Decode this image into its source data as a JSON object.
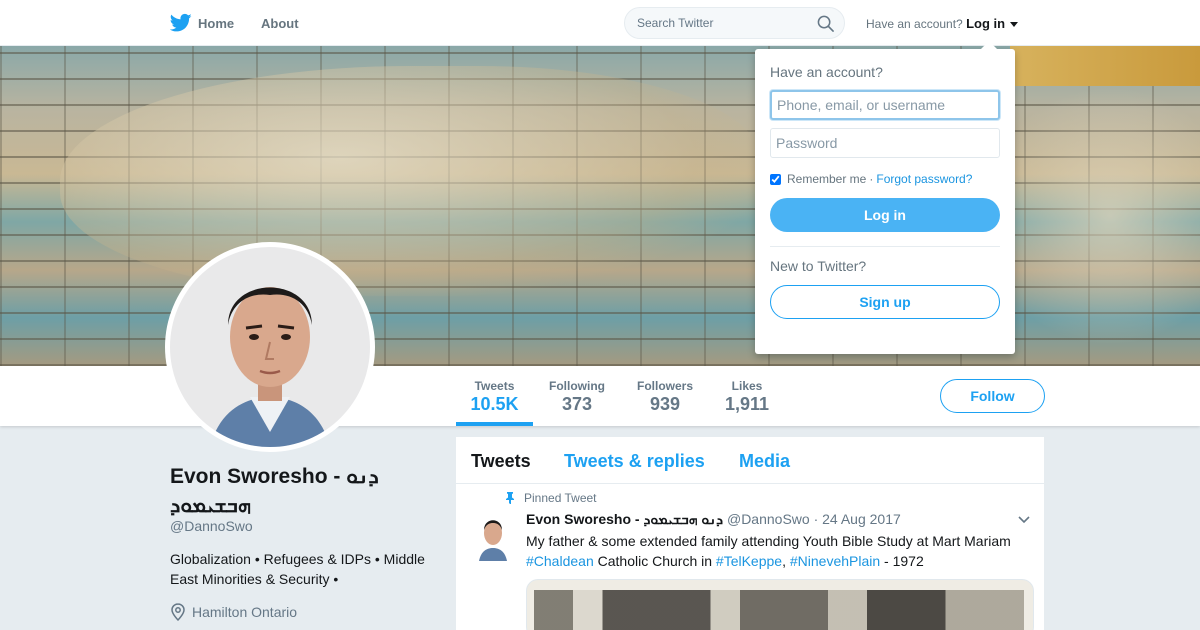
{
  "nav": {
    "home_label": "Home",
    "about_label": "About",
    "search_placeholder": "Search Twitter",
    "have_account": "Have an account?",
    "login_label": "Log in",
    "brand_color": "#1da1f2"
  },
  "login_dropdown": {
    "question": "Have an account?",
    "username_placeholder": "Phone, email, or username",
    "password_placeholder": "Password",
    "remember_label": "Remember me",
    "separator": "·",
    "forgot_label": "Forgot password?",
    "login_button": "Log in",
    "new_question": "New to Twitter?",
    "signup_button": "Sign up"
  },
  "stats": [
    {
      "label": "Tweets",
      "value": "10.5K"
    },
    {
      "label": "Following",
      "value": "373"
    },
    {
      "label": "Followers",
      "value": "939"
    },
    {
      "label": "Likes",
      "value": "1,911"
    }
  ],
  "follow_button": "Follow",
  "profile": {
    "name": "Evon Sworesho - ܕܢܘ ܗܒܫܝܡܘܕ",
    "handle": "@DannoSwo",
    "bio": "Globalization • Refugees & IDPs • Middle East Minorities & Security •",
    "location": "Hamilton Ontario"
  },
  "timeline": {
    "tabs": [
      "Tweets",
      "Tweets & replies",
      "Media"
    ],
    "pinned_label": "Pinned Tweet",
    "tweet": {
      "author": "Evon Sworesho - ܕܢܘ ܗܒܫܝܡܘܕ",
      "handle": "@DannoSwo",
      "separator": "·",
      "date": "24 Aug 2017",
      "text_1": "My father & some extended family attending Youth Bible Study at Mart Mariam ",
      "hashtag_1": "#Chaldean",
      "text_2": " Catholic Church in ",
      "hashtag_2": "#TelKeppe",
      "text_3": ", ",
      "hashtag_3": "#NinevehPlain",
      "text_4": " - 1972"
    }
  }
}
